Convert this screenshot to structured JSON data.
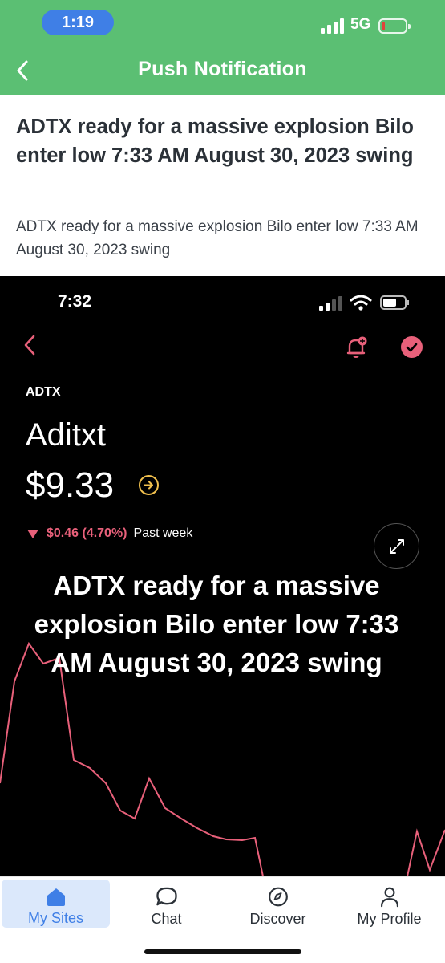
{
  "status_bar": {
    "time": "1:19",
    "network": "5G"
  },
  "header": {
    "title": "Push Notification",
    "back_icon": "chevron-left-icon"
  },
  "notification": {
    "title": "ADTX ready for a massive explosion Bilo enter low 7:33 AM August 30, 2023 swing",
    "body": "ADTX ready for a massive explosion Bilo enter low 7:33 AM August 30, 2023 swing"
  },
  "screenshot": {
    "time": "7:32",
    "ticker": "ADTX",
    "company": "Aditxt",
    "price": "$9.33",
    "change": "$0.46 (4.70%)",
    "period": "Past week",
    "overlay_text": "ADTX ready for a massive explosion Bilo enter low 7:33 AM August 30, 2023 swing",
    "accent_color": "#e8607a",
    "arrow_color": "#f2c14e"
  },
  "tabs": [
    {
      "label": "My Sites",
      "icon": "home-icon",
      "active": true
    },
    {
      "label": "Chat",
      "icon": "chat-bubble-icon",
      "active": false
    },
    {
      "label": "Discover",
      "icon": "compass-icon",
      "active": false
    },
    {
      "label": "My Profile",
      "icon": "person-icon",
      "active": false
    }
  ],
  "colors": {
    "brand_green": "#5bbf73",
    "active_blue": "#3f7fe6"
  }
}
